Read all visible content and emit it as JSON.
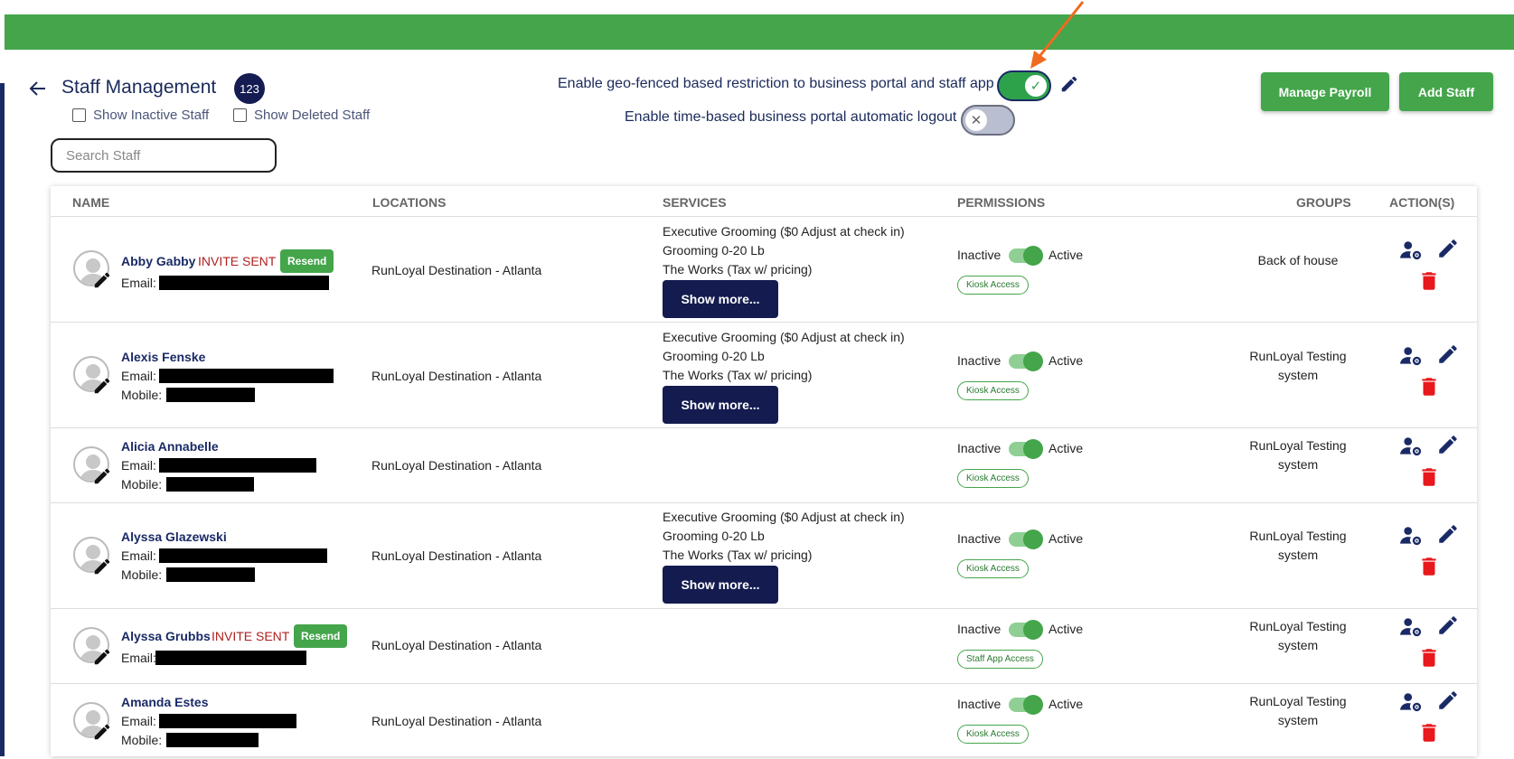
{
  "header": {
    "title": "Staff Management",
    "count": "123",
    "show_inactive_label": "Show Inactive Staff",
    "show_deleted_label": "Show Deleted Staff",
    "search_placeholder": "Search Staff"
  },
  "settings": {
    "geofence_label": "Enable geo-fenced based restriction to business portal and staff app",
    "geofence_enabled": true,
    "autologout_label": "Enable time-based business portal automatic logout",
    "autologout_enabled": false
  },
  "actions": {
    "manage_payroll": "Manage Payroll",
    "add_staff": "Add Staff"
  },
  "columns": [
    "NAME",
    "LOCATIONS",
    "SERVICES",
    "PERMISSIONS",
    "GROUPS",
    "ACTION(S)"
  ],
  "labels": {
    "email": "Email:",
    "mobile": "Mobile:",
    "invite_sent": "INVITE SENT",
    "resend": "Resend",
    "show_more": "Show more...",
    "inactive": "Inactive",
    "active": "Active"
  },
  "rows": [
    {
      "name": "Abby Gabby",
      "invite": true,
      "location": "RunLoyal Destination - Atlanta",
      "services": [
        "Executive Grooming ($0 Adjust at check in)",
        "Grooming 0-20 Lb",
        "The Works (Tax w/ pricing)"
      ],
      "permission": "Kiosk Access",
      "group": "Back of house"
    },
    {
      "name": "Alexis Fenske",
      "invite": false,
      "location": "RunLoyal Destination - Atlanta",
      "services": [
        "Executive Grooming ($0 Adjust at check in)",
        "Grooming 0-20 Lb",
        "The Works (Tax w/ pricing)"
      ],
      "permission": "Kiosk Access",
      "group": "RunLoyal Testing system"
    },
    {
      "name": "Alicia Annabelle",
      "invite": false,
      "location": "RunLoyal Destination - Atlanta",
      "services": [],
      "permission": "Kiosk Access",
      "group": "RunLoyal Testing system"
    },
    {
      "name": "Alyssa Glazewski",
      "invite": false,
      "location": "RunLoyal Destination - Atlanta",
      "services": [
        "Executive Grooming ($0 Adjust at check in)",
        "Grooming 0-20 Lb",
        "The Works (Tax w/ pricing)"
      ],
      "permission": "Kiosk Access",
      "group": "RunLoyal Testing system"
    },
    {
      "name": "Alyssa Grubbs",
      "invite": true,
      "location": "RunLoyal Destination - Atlanta",
      "services": [],
      "permission": "Staff App Access",
      "group": "RunLoyal Testing system"
    },
    {
      "name": "Amanda Estes",
      "invite": false,
      "location": "RunLoyal Destination - Atlanta",
      "services": [],
      "permission": "Kiosk Access",
      "group": "RunLoyal Testing system"
    }
  ]
}
